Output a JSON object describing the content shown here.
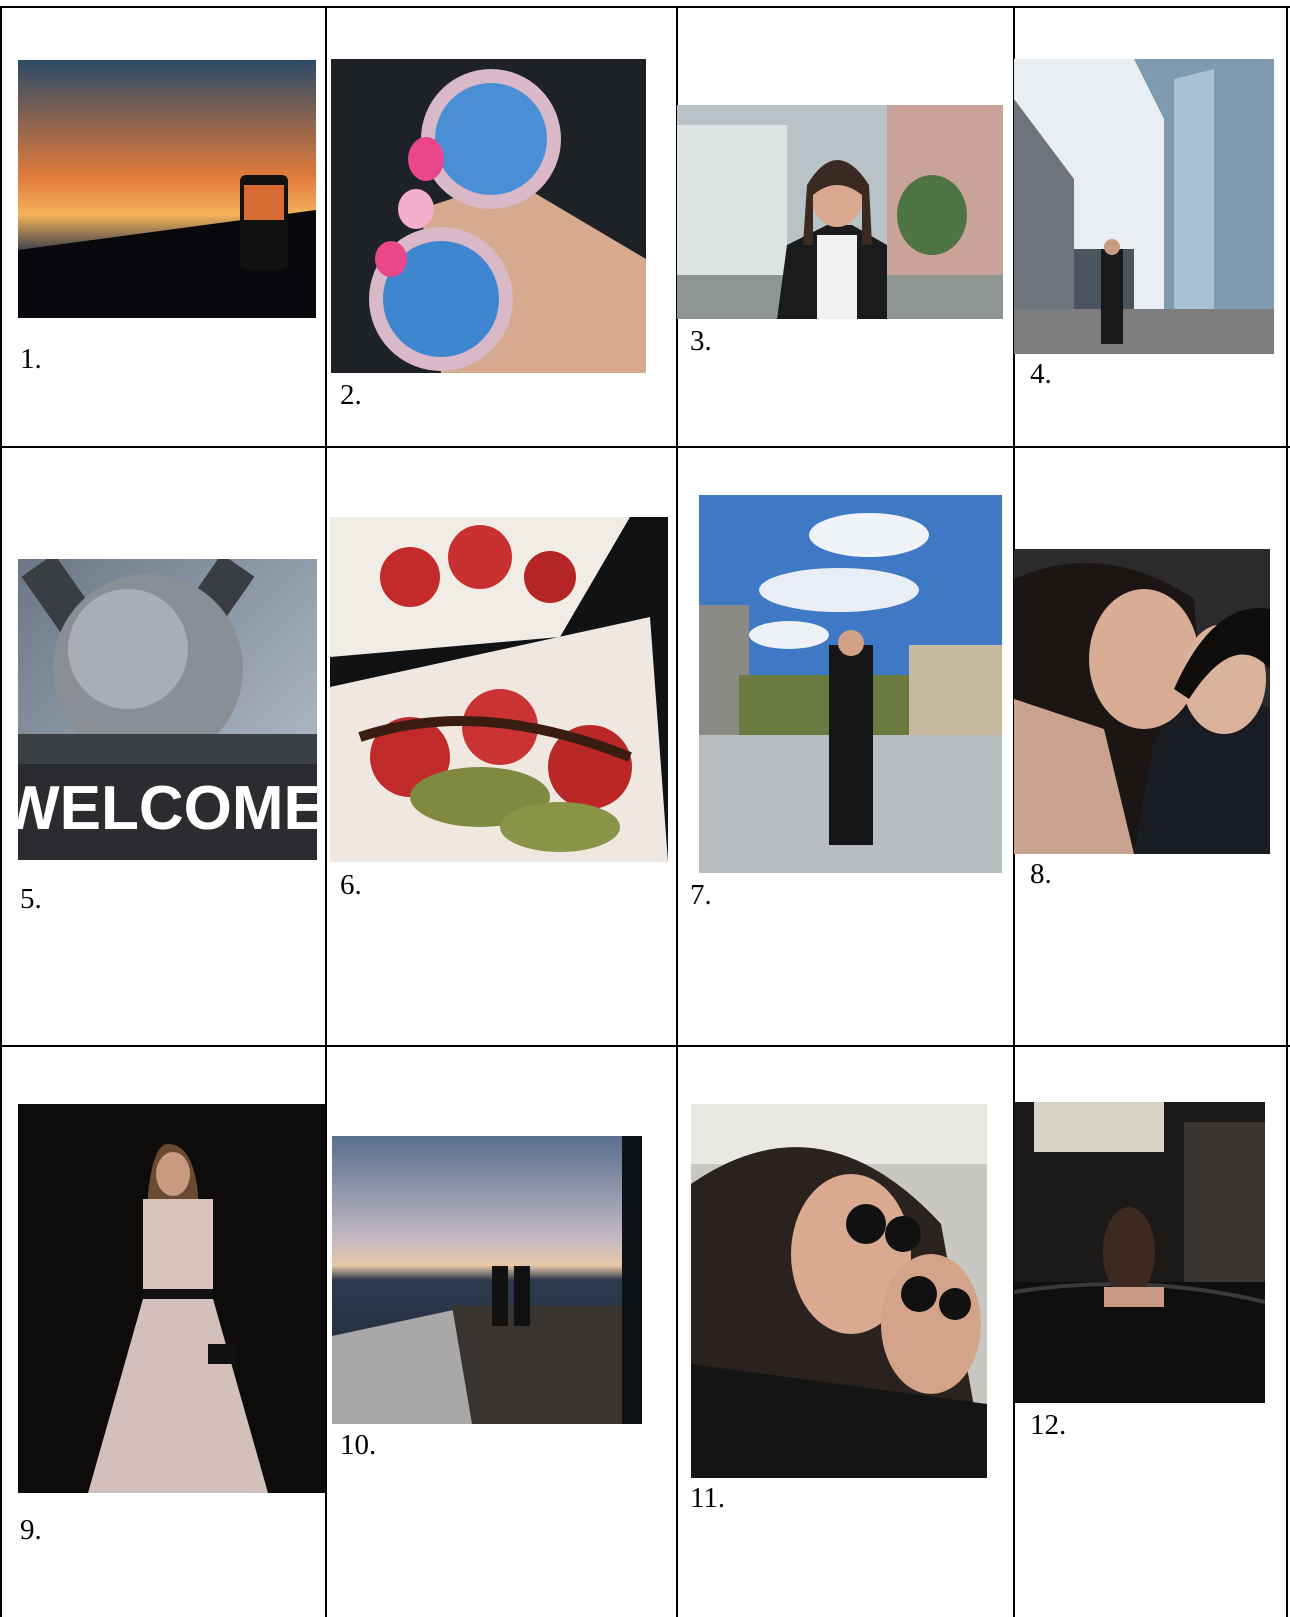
{
  "captions": [
    "1.",
    "2.",
    "3.",
    "4.",
    "5.",
    "6.",
    "7.",
    "8.",
    "9.",
    "10.",
    "11.",
    "12."
  ],
  "colors": {
    "border": "#000000",
    "background": "#ffffff"
  }
}
